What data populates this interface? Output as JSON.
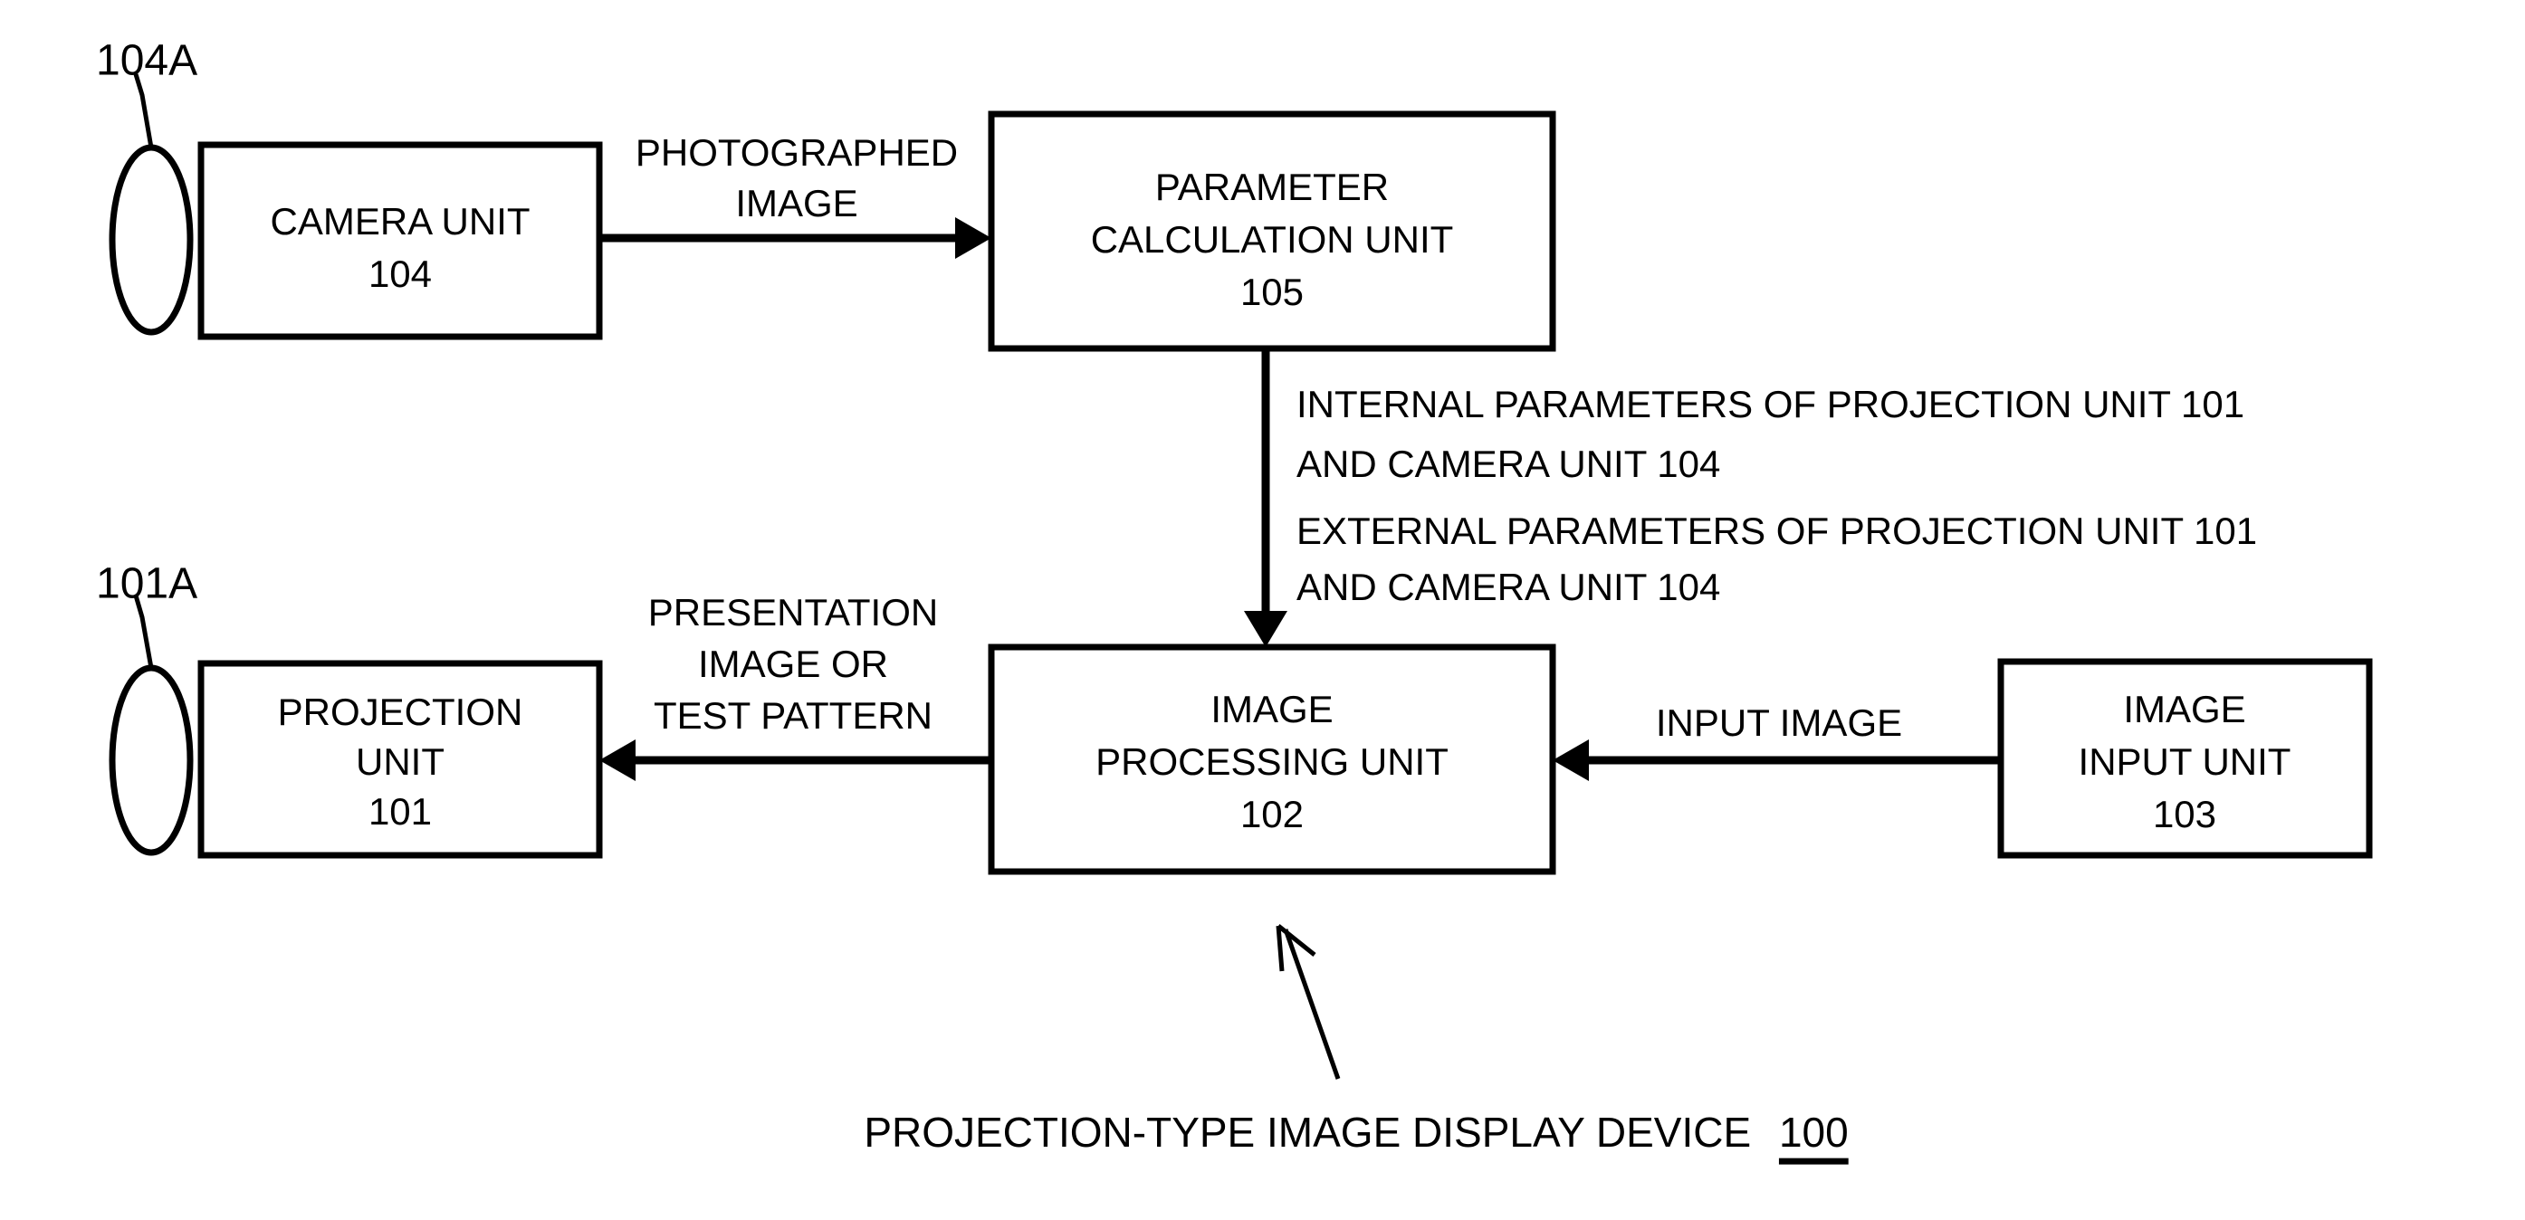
{
  "figure": {
    "domain": "patent-block-diagram",
    "background_color": "#ffffff",
    "line_color": "#000000"
  },
  "blocks": {
    "camera_unit": {
      "line1": "CAMERA UNIT",
      "line2": "104"
    },
    "parameter_calculation_unit": {
      "line1": "PARAMETER",
      "line2": "CALCULATION UNIT",
      "line3": "105"
    },
    "projection_unit": {
      "line1": "PROJECTION",
      "line2": "UNIT",
      "line3": "101"
    },
    "image_processing_unit": {
      "line1": "IMAGE",
      "line2": "PROCESSING UNIT",
      "line3": "102"
    },
    "image_input_unit": {
      "line1": "IMAGE",
      "line2": "INPUT UNIT",
      "line3": "103"
    }
  },
  "reference_labels": {
    "camera_lens": "104A",
    "projection_lens": "101A"
  },
  "edge_labels": {
    "photographed_image": {
      "line1": "PHOTOGRAPHED",
      "line2": "IMAGE"
    },
    "presentation_image": {
      "line1": "PRESENTATION",
      "line2": "IMAGE OR",
      "line3": "TEST PATTERN"
    },
    "input_image": {
      "line1": "INPUT IMAGE"
    },
    "parameters": {
      "internal_line1": "INTERNAL PARAMETERS OF PROJECTION UNIT 101",
      "internal_line2": "AND CAMERA UNIT 104",
      "external_line1": "EXTERNAL PARAMETERS OF PROJECTION UNIT 101",
      "external_line2": "AND CAMERA UNIT 104"
    }
  },
  "caption": {
    "text": "PROJECTION-TYPE IMAGE DISPLAY DEVICE",
    "reference_number": "100"
  }
}
